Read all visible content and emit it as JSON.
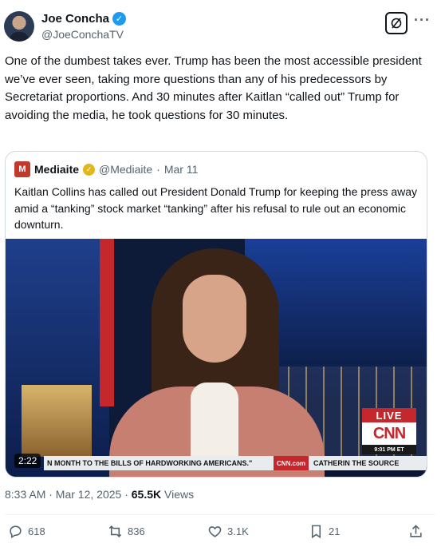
{
  "author": {
    "name": "Joe Concha",
    "handle": "@JoeConchaTV"
  },
  "header_icons": {
    "grok": "grok-icon",
    "more": "···"
  },
  "tweet": {
    "text": "One of the dumbest takes ever. Trump has been the most accessible president we’ve ever seen, taking more questions than any of his predecessors by Secretariat proportions. And 30 minutes after Kaitlan “called out” Trump for avoiding the media, he took questions for 30 minutes."
  },
  "quote": {
    "name": "Mediaite",
    "logo_letter": "M",
    "handle": "@Mediaite",
    "separator": "·",
    "date": "Mar 11",
    "text": "Kaitlan Collins has called out President Donald Trump for keeping the press away amid a “tanking”  stock market “tanking” after his refusal to rule out an economic downturn.",
    "video": {
      "duration": "2:22",
      "live_label": "LIVE",
      "network": "CNN",
      "time": "9:01 PM ET",
      "ticker_text": "N MONTH TO THE BILLS OF HARDWORKING AMERICANS.\"",
      "ticker_site": "CNN.com",
      "ticker_show": "CATHERIN THE SOURCE"
    }
  },
  "meta": {
    "time": "8:33 AM · Mar 12, 2025 · ",
    "views_count": "65.5K",
    "views_label": " Views"
  },
  "actions": {
    "replies": "618",
    "reposts": "836",
    "likes": "3.1K",
    "bookmarks": "21"
  },
  "colors": {
    "verified": "#1d9bf0",
    "text_secondary": "#536471",
    "border": "#cfd9de",
    "cnn_red": "#c4282d"
  }
}
